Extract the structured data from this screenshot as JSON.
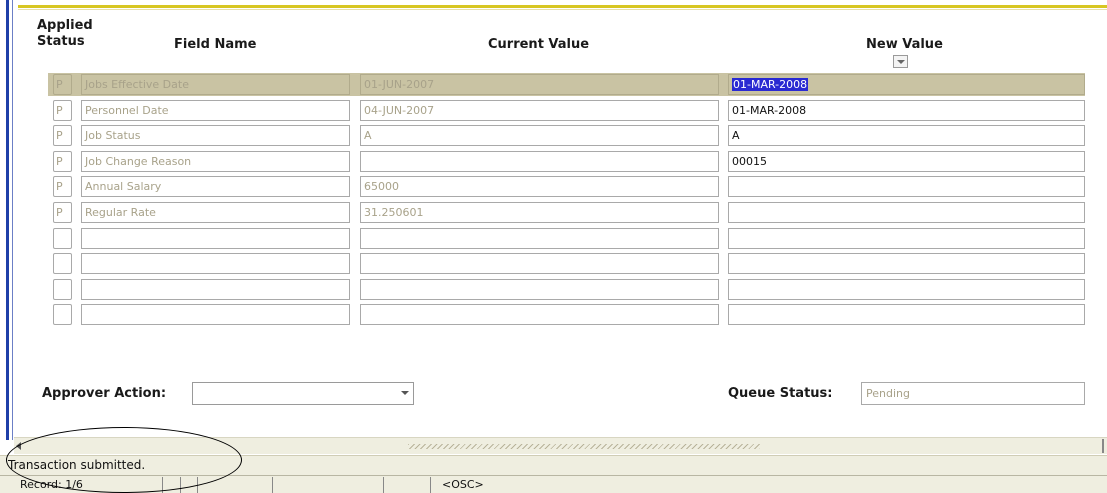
{
  "headers": {
    "applied_line1": "Applied",
    "applied_line2": "Status",
    "field_name": "Field Name",
    "current_value": "Current Value",
    "new_value": "New Value"
  },
  "rows": [
    {
      "status": "P",
      "field": "Jobs Effective Date",
      "current": "01-JUN-2007",
      "new": "01-MAR-2008",
      "selected": true
    },
    {
      "status": "P",
      "field": "Personnel Date",
      "current": "04-JUN-2007",
      "new": "01-MAR-2008"
    },
    {
      "status": "P",
      "field": "Job Status",
      "current": "A",
      "new": "A"
    },
    {
      "status": "P",
      "field": "Job Change Reason",
      "current": "",
      "new": "00015"
    },
    {
      "status": "P",
      "field": "Annual Salary",
      "current": "65000",
      "new": ""
    },
    {
      "status": "P",
      "field": "Regular Rate",
      "current": "31.250601",
      "new": ""
    },
    {
      "status": "",
      "field": "",
      "current": "",
      "new": ""
    },
    {
      "status": "",
      "field": "",
      "current": "",
      "new": ""
    },
    {
      "status": "",
      "field": "",
      "current": "",
      "new": ""
    },
    {
      "status": "",
      "field": "",
      "current": "",
      "new": ""
    }
  ],
  "approver": {
    "label": "Approver Action:",
    "value": ""
  },
  "queue": {
    "label": "Queue Status:",
    "value": "Pending"
  },
  "status_message": "Transaction submitted.",
  "statusbar": {
    "record": "Record: 1/6",
    "osc": "<OSC>"
  },
  "colors": {
    "selected_row_bg": "#c9c3a3",
    "selection_highlight": "#2a2ad2",
    "frame_accent": "#d7c622"
  }
}
